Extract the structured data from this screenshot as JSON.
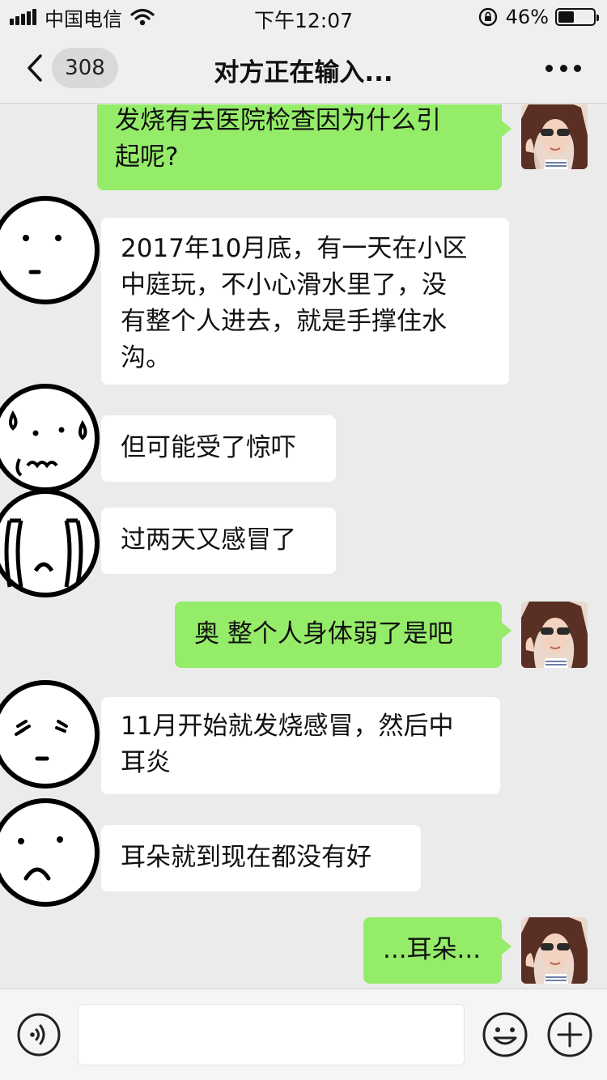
{
  "status_bar": {
    "carrier": "中国电信",
    "time": "下午12:07",
    "battery_percent": "46%",
    "battery_level": 0.46
  },
  "nav": {
    "back_icon": "chevron-left-icon",
    "unread_count": "308",
    "title": "对方正在输入...",
    "more_icon": "more-dots-icon"
  },
  "messages": [
    {
      "sender": "me",
      "lines": [
        "发烧有去医院检查因为什么引",
        "起呢?"
      ]
    },
    {
      "sender": "them",
      "avatar": "plain-face",
      "lines": [
        "2017年10月底，有一天在小区",
        "中庭玩，不小心滑水里了，没",
        "有整个人进去，就是手撑住水",
        "沟。"
      ]
    },
    {
      "sender": "them",
      "avatar": "sweating-face",
      "lines": [
        "但可能受了惊吓"
      ]
    },
    {
      "sender": "them",
      "avatar": "crying-face",
      "lines": [
        "过两天又感冒了"
      ]
    },
    {
      "sender": "me",
      "lines": [
        "奥 整个人身体弱了是吧"
      ]
    },
    {
      "sender": "them",
      "avatar": "frowning-face",
      "lines": [
        "11月开始就发烧感冒，然后中",
        "耳炎"
      ]
    },
    {
      "sender": "them",
      "avatar": "sad-face",
      "lines": [
        "耳朵就到现在都没有好"
      ]
    },
    {
      "sender": "me",
      "lines": [
        "...耳朵..."
      ]
    }
  ],
  "input_bar": {
    "voice_icon": "voice-icon",
    "input_value": "",
    "emoji_icon": "emoji-icon",
    "plus_icon": "plus-icon"
  },
  "colors": {
    "my_bubble": "#95ec69",
    "their_bubble": "#ffffff",
    "background": "#ebebeb"
  }
}
